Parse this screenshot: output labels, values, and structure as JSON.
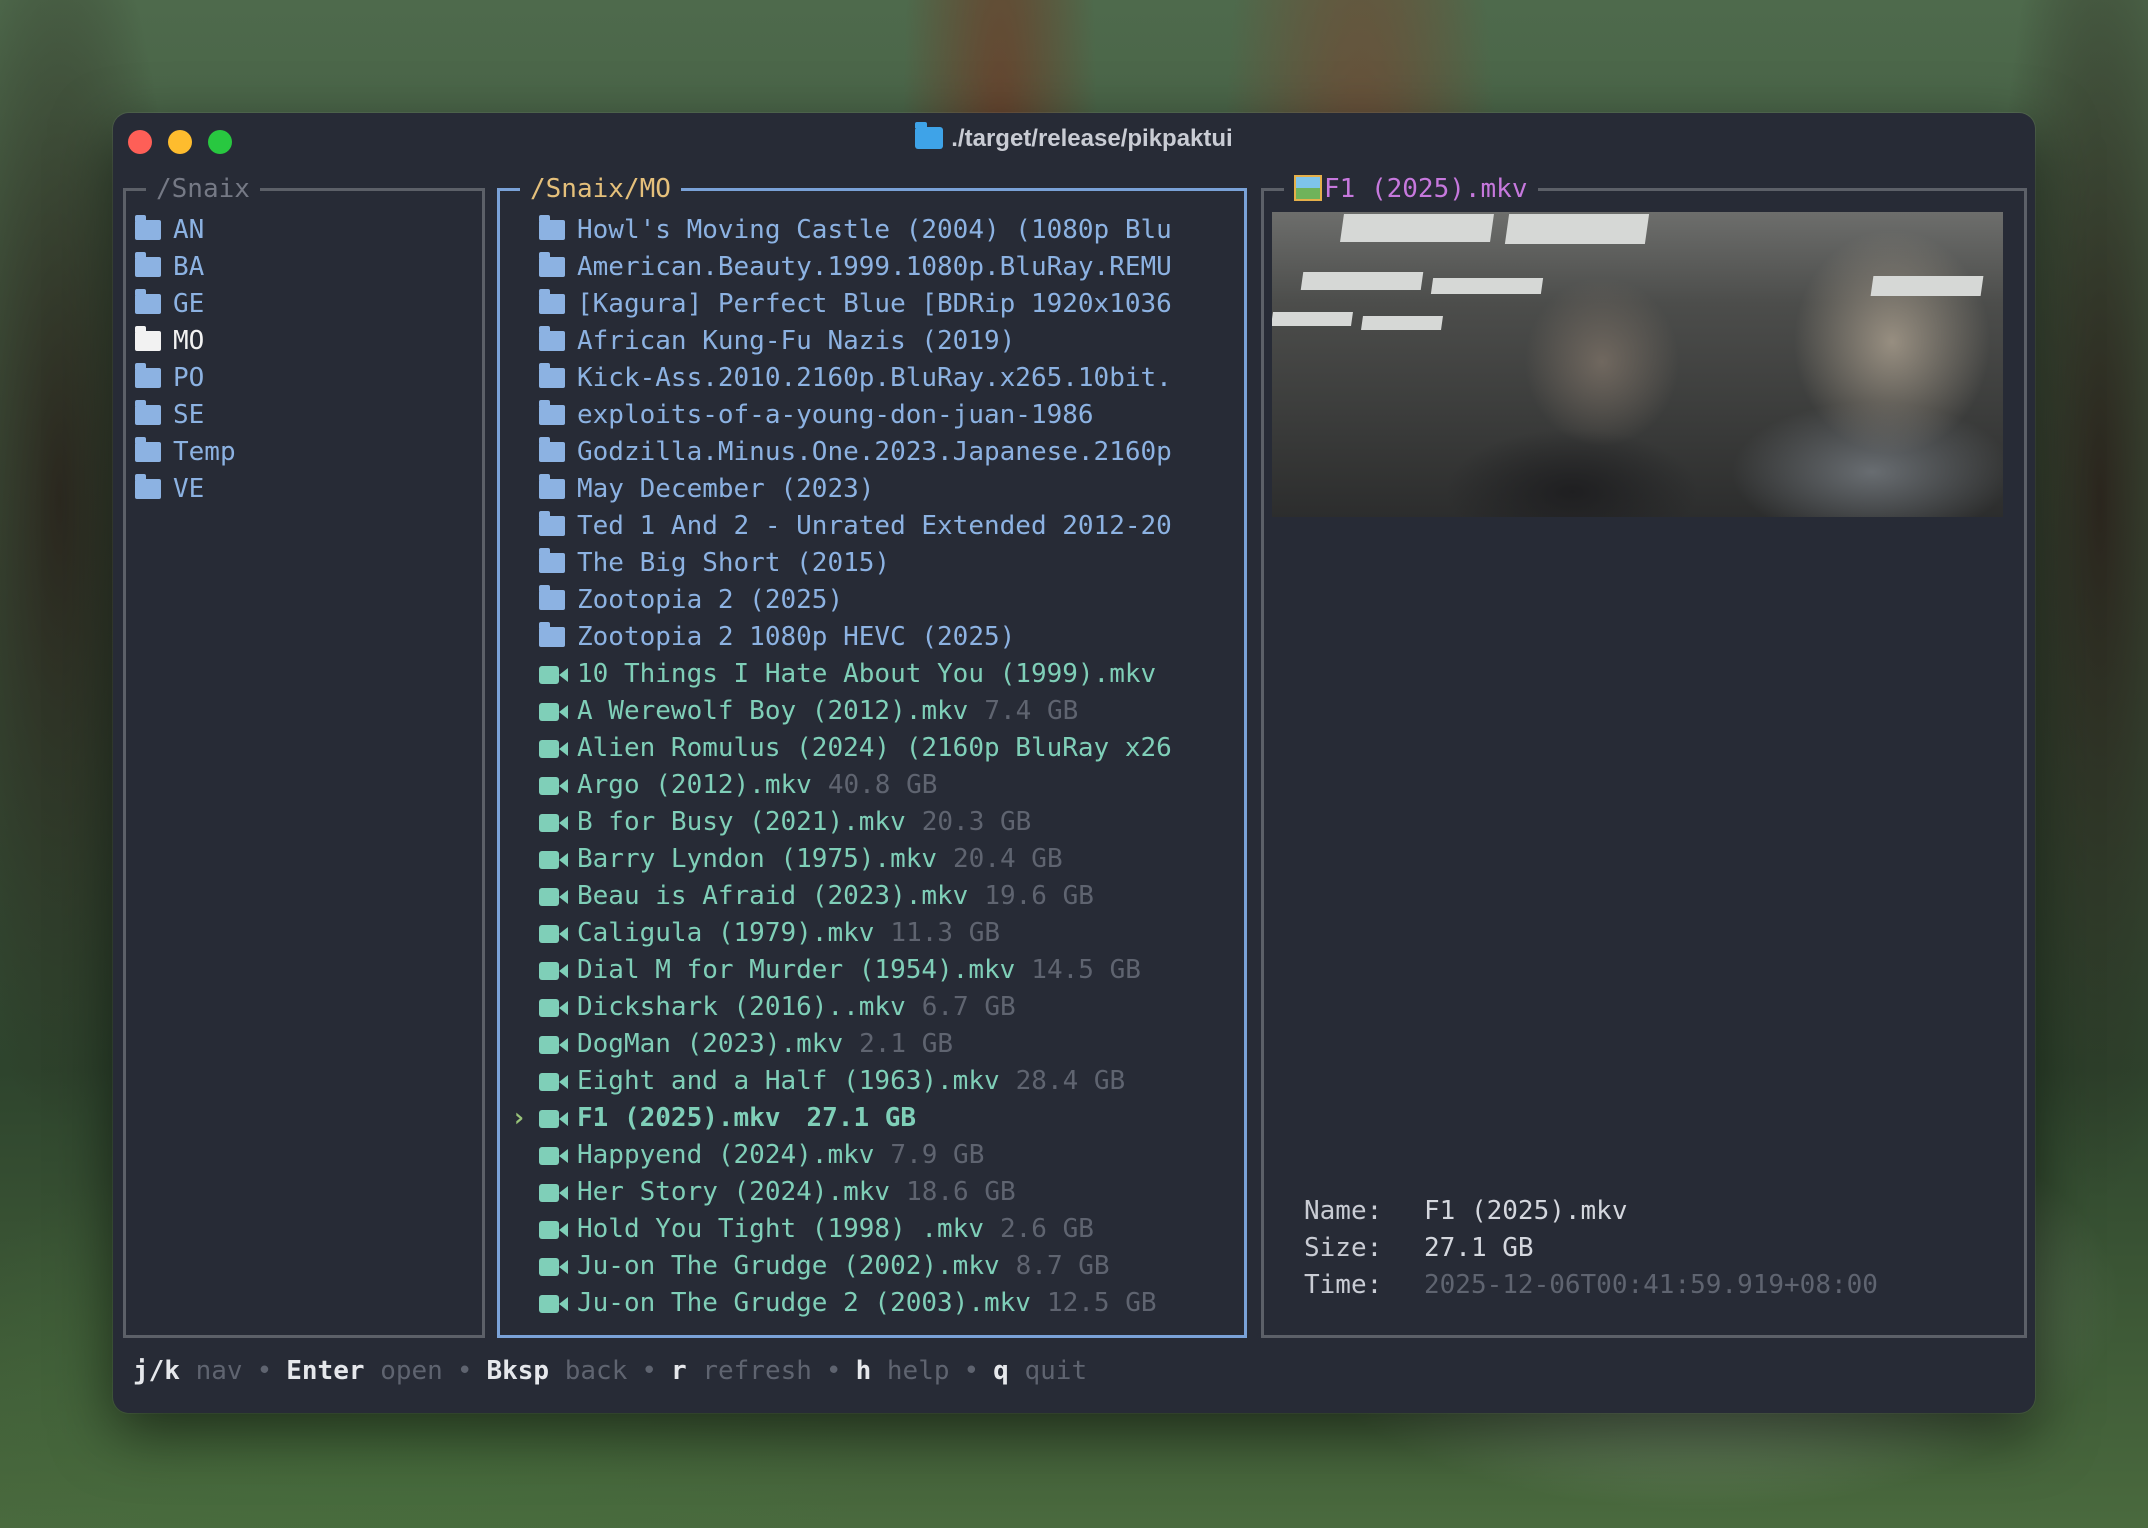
{
  "window": {
    "title": "./target/release/pikpaktui"
  },
  "left_pane": {
    "title": "/Snaix",
    "items": [
      {
        "label": "AN",
        "active": false
      },
      {
        "label": "BA",
        "active": false
      },
      {
        "label": "GE",
        "active": false
      },
      {
        "label": "MO",
        "active": true
      },
      {
        "label": "PO",
        "active": false
      },
      {
        "label": "SE",
        "active": false
      },
      {
        "label": "Temp",
        "active": false
      },
      {
        "label": "VE",
        "active": false
      }
    ]
  },
  "middle_pane": {
    "title": "/Snaix/MO",
    "cursor_symbol": "›",
    "items": [
      {
        "type": "folder",
        "name": "Howl's Moving Castle (2004) (1080p Blu",
        "size": ""
      },
      {
        "type": "folder",
        "name": "American.Beauty.1999.1080p.BluRay.REMU",
        "size": ""
      },
      {
        "type": "folder",
        "name": "[Kagura] Perfect Blue [BDRip 1920x1036",
        "size": ""
      },
      {
        "type": "folder",
        "name": "African Kung-Fu Nazis (2019)",
        "size": ""
      },
      {
        "type": "folder",
        "name": "Kick-Ass.2010.2160p.BluRay.x265.10bit.",
        "size": ""
      },
      {
        "type": "folder",
        "name": "exploits-of-a-young-don-juan-1986",
        "size": ""
      },
      {
        "type": "folder",
        "name": "Godzilla.Minus.One.2023.Japanese.2160p",
        "size": ""
      },
      {
        "type": "folder",
        "name": "May December (2023)",
        "size": ""
      },
      {
        "type": "folder",
        "name": "Ted 1 And 2 - Unrated Extended 2012-20",
        "size": ""
      },
      {
        "type": "folder",
        "name": "The Big Short (2015)",
        "size": ""
      },
      {
        "type": "folder",
        "name": "Zootopia 2 (2025)",
        "size": ""
      },
      {
        "type": "folder",
        "name": "Zootopia 2 1080p HEVC (2025)",
        "size": ""
      },
      {
        "type": "video",
        "name": "10 Things I Hate About You (1999).mkv",
        "size": ""
      },
      {
        "type": "video",
        "name": "A Werewolf Boy (2012).mkv",
        "size": "7.4 GB"
      },
      {
        "type": "video",
        "name": "Alien Romulus (2024) (2160p BluRay x26",
        "size": ""
      },
      {
        "type": "video",
        "name": "Argo (2012).mkv",
        "size": "40.8 GB"
      },
      {
        "type": "video",
        "name": "B for Busy (2021).mkv",
        "size": "20.3 GB"
      },
      {
        "type": "video",
        "name": "Barry Lyndon (1975).mkv",
        "size": "20.4 GB"
      },
      {
        "type": "video",
        "name": "Beau is Afraid (2023).mkv",
        "size": "19.6 GB"
      },
      {
        "type": "video",
        "name": "Caligula (1979).mkv",
        "size": "11.3 GB"
      },
      {
        "type": "video",
        "name": "Dial M for Murder (1954).mkv",
        "size": "14.5 GB"
      },
      {
        "type": "video",
        "name": "Dickshark (2016)..mkv",
        "size": "6.7 GB"
      },
      {
        "type": "video",
        "name": "DogMan (2023).mkv",
        "size": "2.1 GB"
      },
      {
        "type": "video",
        "name": "Eight and a Half (1963).mkv",
        "size": "28.4 GB"
      },
      {
        "type": "video",
        "name": "F1 (2025).mkv",
        "size": "27.1 GB",
        "selected": true
      },
      {
        "type": "video",
        "name": "Happyend (2024).mkv",
        "size": "7.9 GB"
      },
      {
        "type": "video",
        "name": "Her Story (2024).mkv",
        "size": "18.6 GB"
      },
      {
        "type": "video",
        "name": "Hold You Tight (1998) .mkv",
        "size": "2.6 GB"
      },
      {
        "type": "video",
        "name": "Ju-on The Grudge (2002).mkv",
        "size": "8.7 GB"
      },
      {
        "type": "video",
        "name": "Ju-on The Grudge 2 (2003).mkv",
        "size": "12.5 GB"
      }
    ]
  },
  "right_pane": {
    "title": "F1 (2025).mkv",
    "icon": "image-icon",
    "meta": {
      "name_label": "Name:",
      "name_value": "F1 (2025).mkv",
      "size_label": "Size:",
      "size_value": "27.1 GB",
      "time_label": "Time:",
      "time_value": "2025-12-06T00:41:59.919+08:00"
    }
  },
  "statusbar": {
    "items": [
      {
        "key": "j/k",
        "desc": "nav"
      },
      {
        "key": "Enter",
        "desc": "open"
      },
      {
        "key": "Bksp",
        "desc": "back"
      },
      {
        "key": "r",
        "desc": "refresh"
      },
      {
        "key": "h",
        "desc": "help"
      },
      {
        "key": "q",
        "desc": "quit"
      }
    ],
    "separator": "•"
  },
  "colors": {
    "folder": "#8cb2e2",
    "video": "#7fcfb8",
    "size_dim": "#5f6470",
    "active_pane_border": "#7aa2d8",
    "inactive_pane_border": "#5c6068",
    "mid_title": "#e5c07b",
    "right_title": "#c678dd"
  }
}
